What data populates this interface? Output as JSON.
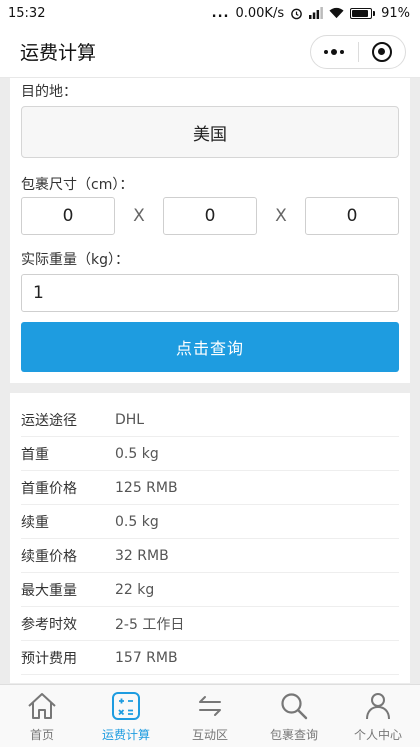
{
  "status_bar": {
    "time": "15:32",
    "dots": "...",
    "speed": "0.00K/s",
    "battery": "91%"
  },
  "nav": {
    "title": "运费计算"
  },
  "form": {
    "destination_label": "目的地：",
    "destination_value": "美国",
    "size_label": "包裹尺寸（cm）：",
    "length": "0",
    "width": "0",
    "height": "0",
    "times_symbol": "X",
    "weight_label": "实际重量（kg）：",
    "weight_value": "1",
    "query_button": "点击查询"
  },
  "results": [
    {
      "key": "运送途径",
      "value": "DHL"
    },
    {
      "key": "首重",
      "value": "0.5 kg"
    },
    {
      "key": "首重价格",
      "value": "125 RMB"
    },
    {
      "key": "续重",
      "value": "0.5 kg"
    },
    {
      "key": "续重价格",
      "value": "32 RMB"
    },
    {
      "key": "最大重量",
      "value": "22 kg"
    },
    {
      "key": "参考时效",
      "value": "2-5 工作日"
    },
    {
      "key": "预计费用",
      "value": "157 RMB"
    }
  ],
  "tabs": [
    {
      "label": "首页",
      "icon": "home-icon",
      "active": false
    },
    {
      "label": "运费计算",
      "icon": "calculator-icon",
      "active": true
    },
    {
      "label": "互动区",
      "icon": "exchange-icon",
      "active": false
    },
    {
      "label": "包裹查询",
      "icon": "search-icon",
      "active": false
    },
    {
      "label": "个人中心",
      "icon": "user-icon",
      "active": false
    }
  ],
  "colors": {
    "accent": "#1e9ce0",
    "background": "#ececec",
    "card": "#ffffff"
  }
}
